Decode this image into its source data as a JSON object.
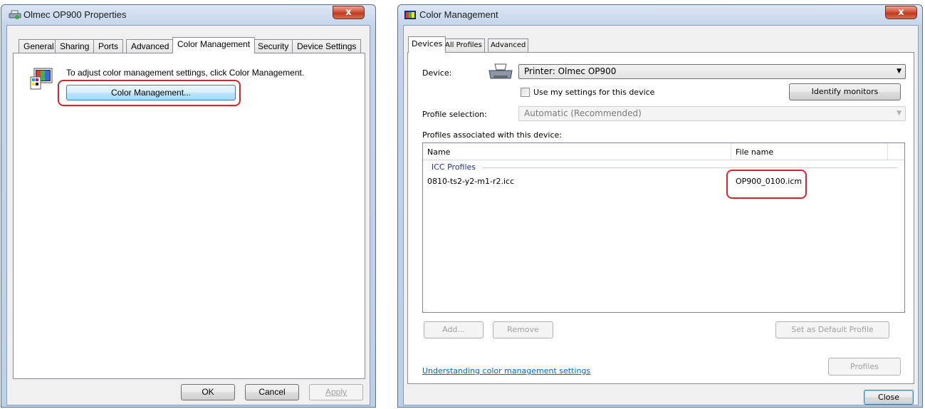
{
  "left_window": {
    "title": "Olmec OP900 Properties",
    "close_label": "x",
    "tabs": [
      {
        "label": "General"
      },
      {
        "label": "Sharing"
      },
      {
        "label": "Ports"
      },
      {
        "label": "Advanced"
      },
      {
        "label": "Color Management"
      },
      {
        "label": "Security"
      },
      {
        "label": "Device Settings"
      }
    ],
    "active_tab": "Color Management",
    "instruction": "To adjust color management settings, click Color Management.",
    "color_management_button": "Color Management...",
    "buttons": {
      "ok": "OK",
      "cancel": "Cancel",
      "apply": "Apply"
    }
  },
  "right_window": {
    "title": "Color Management",
    "close_label": "x",
    "tabs": [
      {
        "label": "Devices"
      },
      {
        "label": "All Profiles"
      },
      {
        "label": "Advanced"
      }
    ],
    "active_tab": "Devices",
    "device_label": "Device:",
    "device_value": "Printer: Olmec OP900",
    "use_my_settings_label": "Use my settings for this device",
    "use_my_settings_checked": false,
    "identify_monitors": "Identify monitors",
    "profile_selection_label": "Profile selection:",
    "profile_selection_value": "Automatic (Recommended)",
    "profiles_associated_label": "Profiles associated with this device:",
    "table": {
      "columns": [
        "Name",
        "File name"
      ],
      "group": "ICC Profiles",
      "rows": [
        {
          "name": "0810-ts2-y2-m1-r2.icc",
          "file": "OP900_0100.icm"
        }
      ]
    },
    "buttons": {
      "add": "Add...",
      "remove": "Remove",
      "set_default": "Set as Default Profile",
      "profiles": "Profiles",
      "close": "Close"
    },
    "link": "Understanding color management settings"
  },
  "colors": {
    "highlight": "#e0202a",
    "link": "#0066cc",
    "group_header": "#1e3287"
  }
}
